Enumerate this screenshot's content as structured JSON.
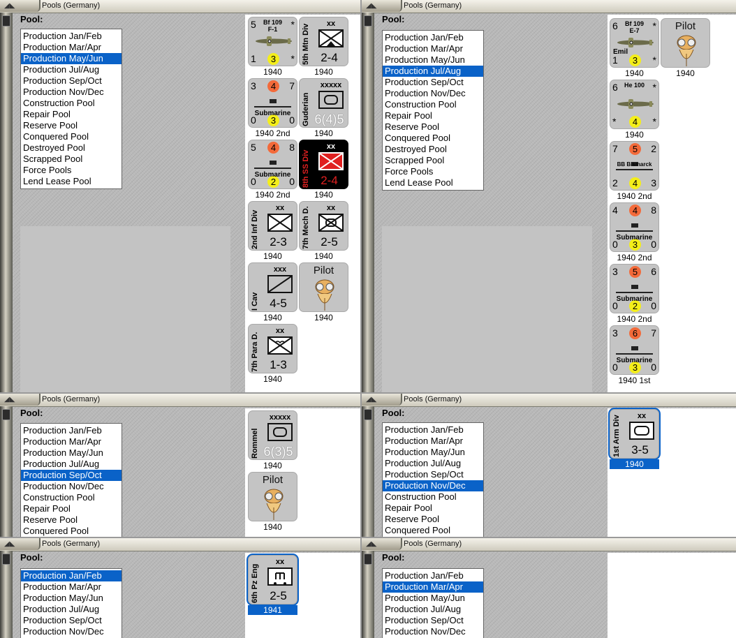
{
  "window_title": "Pools (Germany)",
  "pool_label": "Pool:",
  "pools": [
    "Production Jan/Feb",
    "Production Mar/Apr",
    "Production May/Jun",
    "Production Jul/Aug",
    "Production Sep/Oct",
    "Production Nov/Dec",
    "Construction Pool",
    "Repair Pool",
    "Reserve Pool",
    "Conquered Pool",
    "Destroyed Pool",
    "Scrapped Pool",
    "Force Pools",
    "Lend Lease Pool"
  ],
  "panel1": {
    "selected": "Production May/Jun",
    "counters": [
      {
        "kind": "plane",
        "name": "Bf 109",
        "sub": "F-1",
        "tl": "5",
        "tr": "*",
        "bl": "1",
        "br": "*",
        "dot": "3",
        "dotc": "y",
        "year": "1940"
      },
      {
        "kind": "unit",
        "vlabel": "5th Mtn Div",
        "size": "xx",
        "str": "2-4",
        "year": "1940"
      },
      {
        "kind": "ship",
        "name": "Submarine",
        "tl": "3",
        "tm": "4",
        "tr": "7",
        "bl": "0",
        "bm": "3",
        "br": "0",
        "year": "1940 2nd"
      },
      {
        "kind": "leader",
        "vlabel": "Guderian",
        "size": "xxxxx",
        "str": "6(4)5",
        "year": "1940"
      },
      {
        "kind": "ship",
        "name": "Submarine",
        "tl": "5",
        "tm": "4",
        "tr": "8",
        "bl": "0",
        "bm": "2",
        "br": "0",
        "year": "1940 2nd"
      },
      {
        "kind": "ss",
        "vlabel": "8th SS Div",
        "size": "xx",
        "str": "2-4",
        "year": "1940"
      },
      {
        "kind": "unit",
        "vlabel": "2nd Inf Div",
        "size": "xx",
        "str": "2-3",
        "year": "1940"
      },
      {
        "kind": "unit",
        "vlabel": "7th Mech D.",
        "size": "xx",
        "str": "2-5",
        "year": "1940"
      },
      {
        "kind": "cav",
        "vlabel": "I Cav",
        "size": "xxx",
        "str": "4-5",
        "year": "1940"
      },
      {
        "kind": "pilot",
        "title": "Pilot",
        "year": "1940"
      },
      {
        "kind": "unit",
        "vlabel": "7th Para D.",
        "size": "xx",
        "str": "1-3",
        "year": "1940"
      }
    ]
  },
  "panel2": {
    "selected": "Production Jul/Aug",
    "counters": [
      {
        "kind": "plane",
        "name": "Bf 109",
        "sub": "E-7",
        "extra": "Emil",
        "tl": "6",
        "tr": "*",
        "bl": "1",
        "br": "*",
        "dot": "3",
        "dotc": "y",
        "year": "1940"
      },
      {
        "kind": "pilot",
        "title": "Pilot",
        "year": "1940"
      },
      {
        "kind": "plane",
        "name": "He 100",
        "sub": "",
        "tl": "6",
        "tr": "*",
        "bl": "*",
        "br": "*",
        "dot": "4",
        "dotc": "y",
        "year": "1940"
      },
      {
        "kind": "ship",
        "name": "BB Bismarck",
        "tl": "7",
        "tm": "5",
        "tr": "2",
        "bl": "2",
        "bm": "4",
        "br": "3",
        "year": "1940 2nd"
      },
      {
        "kind": "ship",
        "name": "Submarine",
        "tl": "4",
        "tm": "4",
        "tr": "8",
        "bl": "0",
        "bm": "3",
        "br": "0",
        "year": "1940 2nd"
      },
      {
        "kind": "ship",
        "name": "Submarine",
        "tl": "3",
        "tm": "5",
        "tr": "6",
        "bl": "0",
        "bm": "2",
        "br": "0",
        "year": "1940 2nd"
      },
      {
        "kind": "ship",
        "name": "Submarine",
        "tl": "3",
        "tm": "6",
        "tr": "7",
        "bl": "0",
        "bm": "3",
        "br": "0",
        "year": "1940 1st"
      }
    ]
  },
  "panel3": {
    "selected": "Production Sep/Oct",
    "counters": [
      {
        "kind": "leader",
        "vlabel": "Rommel",
        "size": "xxxxx",
        "str": "6(3)5",
        "year": "1940"
      },
      {
        "kind": "pilot",
        "title": "Pilot",
        "year": "1940"
      }
    ]
  },
  "panel4": {
    "selected": "Production Nov/Dec",
    "counters": [
      {
        "kind": "armor",
        "vlabel": "1st Arm Div",
        "size": "xx",
        "str": "3-5",
        "year": "1940",
        "selected": true
      }
    ]
  },
  "panel5": {
    "selected": "Production Jan/Feb",
    "counters": [
      {
        "kind": "eng",
        "vlabel": "6th Pz Eng",
        "size": "xx",
        "str": "2-5",
        "year": "1941",
        "selected": true
      }
    ]
  },
  "panel6": {
    "selected": "Production Mar/Apr",
    "counters": []
  },
  "colors": {
    "selection": "#0a62c8",
    "dot_yellow": "#f4ee1a",
    "dot_orange": "#f36a3a",
    "ss_red": "#e02020"
  }
}
